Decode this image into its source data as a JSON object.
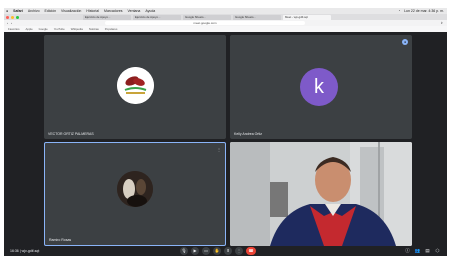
{
  "browser": {
    "menu_items": [
      "Safari",
      "Archivo",
      "Edición",
      "Visualización",
      "Historial",
      "Marcadores",
      "Ventana",
      "Ayuda"
    ],
    "status_right": "Lun 22 de mar. 4:36 p. m.",
    "tabs": [
      "Ejercicio de Apoyo...",
      "Ejercicio de Apoyo...",
      "Google Sheets...",
      "Google Sheets...",
      "Meet - wjv-gdif-sqt"
    ],
    "url": "meet.google.com",
    "bookmarks": [
      "Favoritos",
      "Apple",
      "Google",
      "YouTube",
      "Wikipedia",
      "Noticias",
      "Populares"
    ]
  },
  "tiles": [
    {
      "name": "VECTOR ORTIZ PALMERAS",
      "avatar": "cacao-logo"
    },
    {
      "name": "Kelly Andrea Ortiz",
      "avatar_letter": "k",
      "avatar_color": "#7e5ac9"
    },
    {
      "name": "Ramiro Rosas",
      "avatar": "photo"
    },
    {
      "name": "",
      "avatar": "video"
    }
  ],
  "meeting": {
    "time": "16:36",
    "code": "wjv-gdif-sqt"
  },
  "colors": {
    "stage": "#202124",
    "tile": "#3c4043",
    "hangup": "#ea4335",
    "highlight": "#8ab4f8"
  }
}
